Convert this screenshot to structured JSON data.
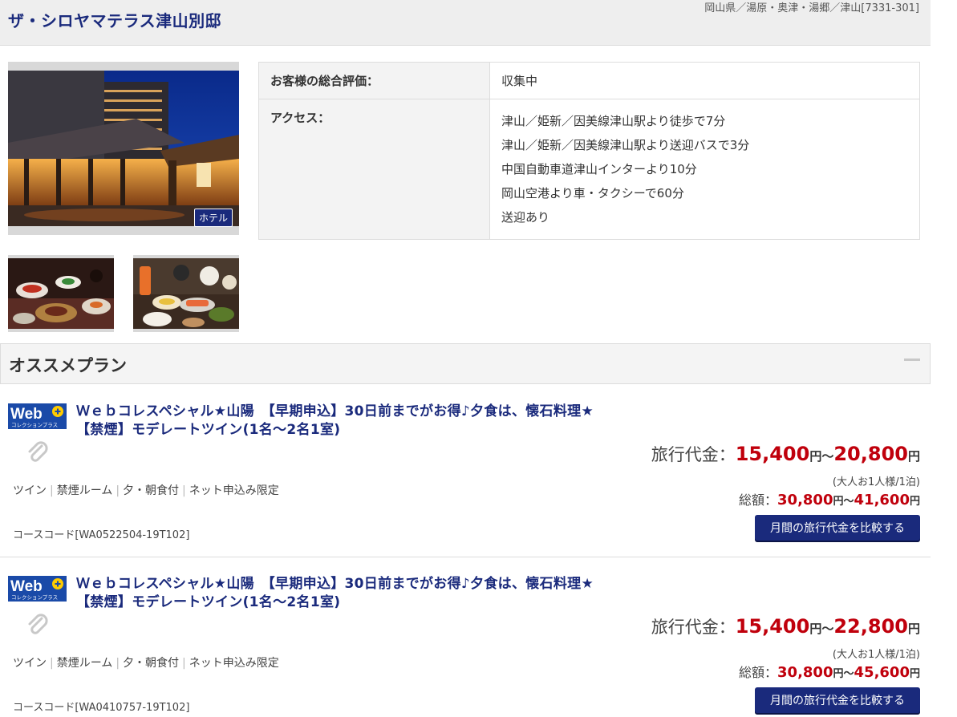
{
  "header": {
    "hotel_name": "ザ・シロヤマテラス津山別邸",
    "location": "岡山県／湯原・奥津・湯郷／津山[7331-301]"
  },
  "photos": {
    "hotel_badge": "ホテル"
  },
  "info": {
    "rating_label": "お客様の総合評価：",
    "rating_value": "収集中",
    "access_label": "アクセス：",
    "access": [
      "津山／姫新／因美線津山駅より徒歩で7分",
      "津山／姫新／因美線津山駅より送迎バスで3分",
      "中国自動車道津山インターより10分",
      "岡山空港より車・タクシーで60分",
      "送迎あり"
    ]
  },
  "section": {
    "title": "オススメプラン"
  },
  "plans": [
    {
      "logo_text": "Web",
      "logo_sub": "コレクションプラス",
      "title": "Ｗｅｂコレスペシャル★山陽　【早期申込】30日前までがお得♪夕食は、懐石料理★ 【禁煙】モデレートツイン(1名～2名1室)",
      "tags": [
        "ツイン",
        "禁煙ルーム",
        "夕・朝食付",
        "ネット申込み限定"
      ],
      "course_code": "コースコード[WA0522504-19T102]",
      "price_label": "旅行代金：",
      "price_min": "15,400",
      "price_max": "20,800",
      "yen": "円",
      "tilde": "～",
      "per_note": "(大人お1人様/1泊)",
      "total_label": "総額：",
      "total_min": "30,800",
      "total_max": "41,600",
      "compare_label": "月間の旅行代金を比較する"
    },
    {
      "logo_text": "Web",
      "logo_sub": "コレクションプラス",
      "title": "Ｗｅｂコレスペシャル★山陽　【早期申込】30日前までがお得♪夕食は、懐石料理★ 【禁煙】モデレートツイン(1名～2名1室)",
      "tags": [
        "ツイン",
        "禁煙ルーム",
        "夕・朝食付",
        "ネット申込み限定"
      ],
      "course_code": "コースコード[WA0410757-19T102]",
      "price_label": "旅行代金：",
      "price_min": "15,400",
      "price_max": "22,800",
      "yen": "円",
      "tilde": "～",
      "per_note": "(大人お1人様/1泊)",
      "total_label": "総額：",
      "total_min": "30,800",
      "total_max": "45,600",
      "compare_label": "月間の旅行代金を比較する"
    }
  ],
  "colors": {
    "brand_navy": "#1a2a7c",
    "price_red": "#c0000c"
  }
}
